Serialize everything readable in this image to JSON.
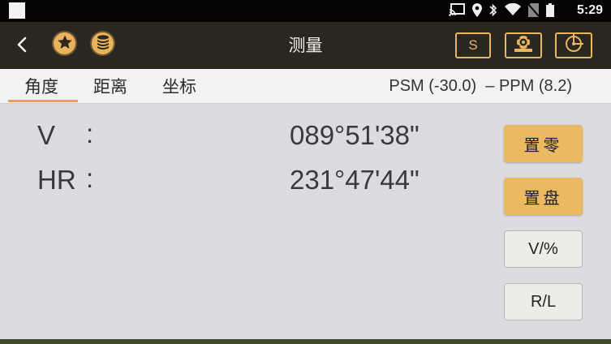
{
  "status_bar": {
    "time": "5:29",
    "icons": [
      "cast-icon",
      "location-icon",
      "bluetooth-icon",
      "wifi-icon",
      "no-sim-icon",
      "battery-icon"
    ]
  },
  "toolbar": {
    "title": "测量",
    "s_button_label": "S",
    "icons": [
      "back-icon",
      "star-icon",
      "database-icon",
      "target-icon",
      "crosshair-icon"
    ]
  },
  "tabs": {
    "items": [
      {
        "label": "角度"
      },
      {
        "label": "距离"
      },
      {
        "label": "坐标"
      }
    ],
    "active_index": 0,
    "psm_ppm": "PSM (-30.0)  – PPM (8.2)"
  },
  "measurements": [
    {
      "label": "V",
      "colon": ":",
      "value": "089°51'38\""
    },
    {
      "label": "HR",
      "colon": ":",
      "value": "231°47'44\""
    }
  ],
  "side_buttons": {
    "zero": "置零",
    "set": "置盘",
    "v_percent": "V/%",
    "r_l": "R/L"
  },
  "colors": {
    "accent": "#e9b65f",
    "toolbar_bg": "#2a2721",
    "content_bg": "#dcdce0"
  }
}
